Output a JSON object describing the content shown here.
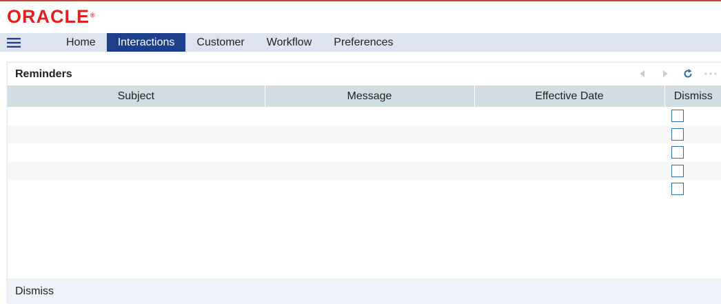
{
  "brand": {
    "name": "ORACLE",
    "mark": "®",
    "color": "#e02020"
  },
  "nav": {
    "menu_icon": "hamburger-icon",
    "tabs": [
      {
        "label": "Home",
        "active": false
      },
      {
        "label": "Interactions",
        "active": true
      },
      {
        "label": "Customer",
        "active": false
      },
      {
        "label": "Workflow",
        "active": false
      },
      {
        "label": "Preferences",
        "active": false
      }
    ],
    "active_color": "#1e3f8a"
  },
  "reminders": {
    "title": "Reminders",
    "toolbar": [
      "previous-icon",
      "next-icon",
      "refresh-icon",
      "more-icon"
    ],
    "columns": [
      "Subject",
      "Message",
      "Effective Date",
      "Dismiss"
    ],
    "rows": [
      {
        "subject": "",
        "message": "",
        "effective_date": "",
        "dismiss": false
      },
      {
        "subject": "",
        "message": "",
        "effective_date": "",
        "dismiss": false
      },
      {
        "subject": "",
        "message": "",
        "effective_date": "",
        "dismiss": false
      },
      {
        "subject": "",
        "message": "",
        "effective_date": "",
        "dismiss": false
      },
      {
        "subject": "",
        "message": "",
        "effective_date": "",
        "dismiss": false
      }
    ],
    "footer_button": "Dismiss"
  }
}
